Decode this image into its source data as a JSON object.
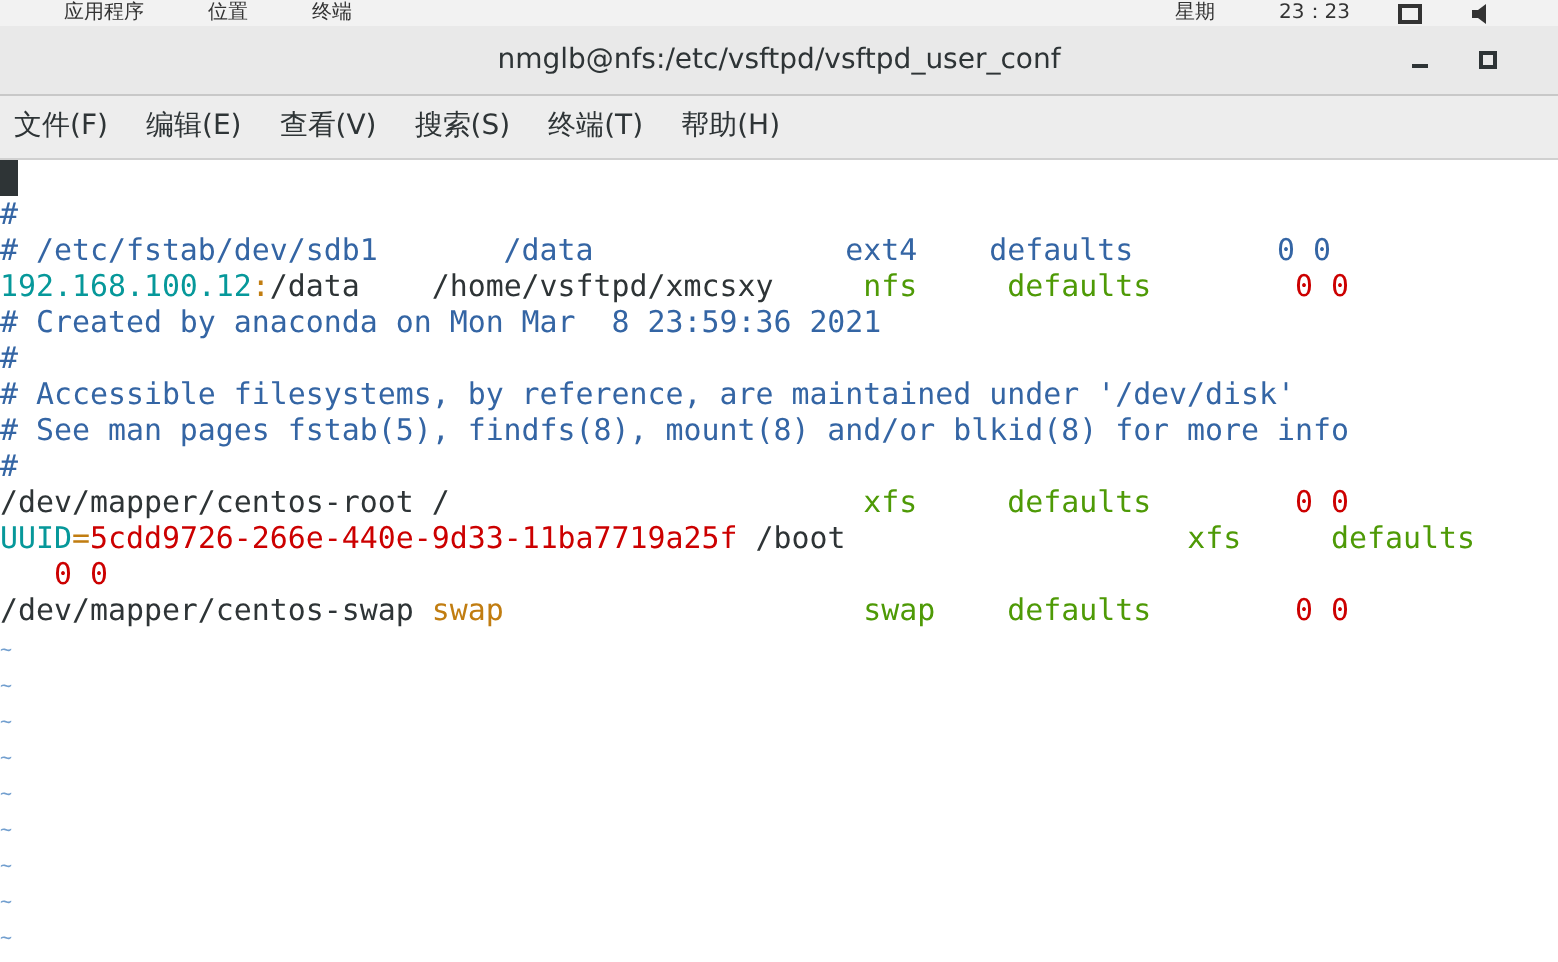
{
  "top_panel": {
    "left": [
      "应用程序",
      "位置",
      "终端"
    ],
    "right": [
      "星期",
      "23：23"
    ]
  },
  "window": {
    "title": "nmglb@nfs:/etc/vsftpd/vsftpd_user_conf"
  },
  "menu": [
    "文件(F)",
    "编辑(E)",
    "查看(V)",
    "搜索(S)",
    "终端(T)",
    "帮助(H)"
  ],
  "lines": [
    {
      "kind": "cursor"
    },
    {
      "kind": "text",
      "segments": [
        {
          "text": "#",
          "kind": "comment"
        }
      ]
    },
    {
      "kind": "text",
      "segments": [
        {
          "text": "# /etc/fstab/dev/sdb1       /data              ext4    defaults        0 0",
          "kind": "comment"
        }
      ]
    },
    {
      "kind": "text",
      "segments": [
        {
          "text": "192.168.100.12",
          "kind": "host"
        },
        {
          "text": ":",
          "kind": "punct"
        },
        {
          "text": "/data    /home/vsftpd/xmcsxy",
          "kind": "path"
        },
        {
          "text": "     nfs     defaults",
          "kind": "option"
        },
        {
          "text": "        0 0",
          "kind": "number"
        }
      ]
    },
    {
      "kind": "text",
      "segments": [
        {
          "text": "# Created by anaconda on Mon Mar  8 23:59:36 2021",
          "kind": "comment"
        }
      ]
    },
    {
      "kind": "text",
      "segments": [
        {
          "text": "#",
          "kind": "comment"
        }
      ]
    },
    {
      "kind": "text",
      "segments": [
        {
          "text": "# Accessible filesystems, by reference, are maintained under '/dev/disk'",
          "kind": "comment"
        }
      ]
    },
    {
      "kind": "text",
      "segments": [
        {
          "text": "# See man pages fstab(5), findfs(8), mount(8) and/or blkid(8) for more info",
          "kind": "comment"
        }
      ]
    },
    {
      "kind": "text",
      "segments": [
        {
          "text": "#",
          "kind": "comment"
        }
      ]
    },
    {
      "kind": "text",
      "segments": [
        {
          "text": "/dev/mapper/centos-root /",
          "kind": "path"
        },
        {
          "text": "                       xfs     defaults",
          "kind": "option"
        },
        {
          "text": "        0 0",
          "kind": "number"
        }
      ]
    },
    {
      "kind": "text",
      "segments": [
        {
          "text": "UUID",
          "kind": "host"
        },
        {
          "text": "=",
          "kind": "punct"
        },
        {
          "text": "5cdd9726-266e-440e-9d33-11ba7719a25f",
          "kind": "number"
        },
        {
          "text": " /boot",
          "kind": "path"
        },
        {
          "text": "                   xfs     defaults",
          "kind": "option"
        }
      ]
    },
    {
      "kind": "text",
      "segments": [
        {
          "text": "   0 0",
          "kind": "number"
        }
      ]
    },
    {
      "kind": "text",
      "segments": [
        {
          "text": "/dev/mapper/centos-swap",
          "kind": "path"
        },
        {
          "text": " swap",
          "kind": "punct"
        },
        {
          "text": "                    swap    defaults",
          "kind": "option"
        },
        {
          "text": "        0 0",
          "kind": "number"
        }
      ]
    },
    {
      "kind": "tilde",
      "text": "~"
    },
    {
      "kind": "tilde",
      "text": "~"
    },
    {
      "kind": "tilde",
      "text": "~"
    },
    {
      "kind": "tilde",
      "text": "~"
    },
    {
      "kind": "tilde",
      "text": "~"
    },
    {
      "kind": "tilde",
      "text": "~"
    },
    {
      "kind": "tilde",
      "text": "~"
    },
    {
      "kind": "tilde",
      "text": "~"
    },
    {
      "kind": "tilde",
      "text": "~"
    }
  ]
}
